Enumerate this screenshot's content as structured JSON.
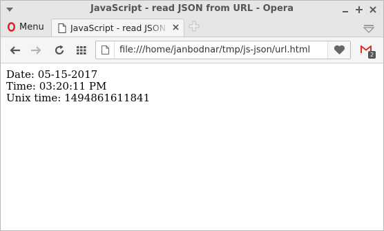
{
  "window": {
    "title": "JavaScript - read JSON from URL - Opera",
    "controls": [
      "minimize-icon",
      "maximize-icon",
      "close-icon"
    ]
  },
  "tabstrip": {
    "menu_label": "Menu",
    "tabs": [
      {
        "title": "JavaScript - read JSON fro",
        "icon": "document-icon"
      }
    ]
  },
  "toolbar": {
    "icons": [
      "back-arrow-icon",
      "forward-arrow-icon",
      "reload-icon",
      "speed-dial-grid-icon"
    ],
    "url": "file:///home/janbodnar/tmp/js-json/url.html",
    "gmail_badge": "2"
  },
  "content": {
    "lines": [
      "Date: 05-15-2017",
      "Time: 03:20:11 PM",
      "Unix time: 1494861611841"
    ]
  },
  "colors": {
    "opera_red": "#e21b1b",
    "chrome_bg": "#e6e6e6",
    "toolbar_bg": "#f5f5f5"
  }
}
